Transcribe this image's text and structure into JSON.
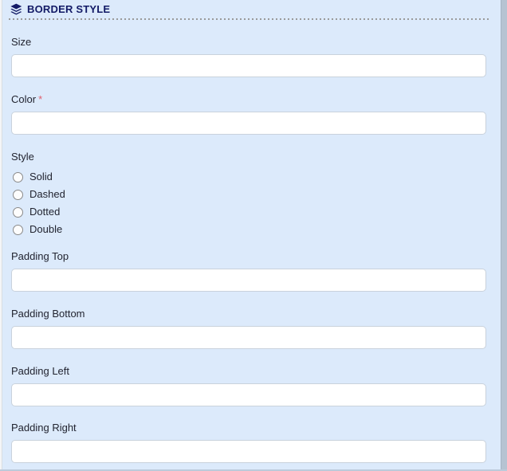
{
  "section": {
    "title": "BORDER STYLE",
    "icon": "layers-icon"
  },
  "fields": {
    "size": {
      "label": "Size",
      "value": "",
      "placeholder": ""
    },
    "color": {
      "label": "Color",
      "required_marker": "*",
      "value": "",
      "placeholder": ""
    },
    "style": {
      "label": "Style",
      "options": [
        "Solid",
        "Dashed",
        "Dotted",
        "Double"
      ],
      "selected": ""
    },
    "padding_top": {
      "label": "Padding Top",
      "value": "",
      "placeholder": ""
    },
    "padding_bottom": {
      "label": "Padding Bottom",
      "value": "",
      "placeholder": ""
    },
    "padding_left": {
      "label": "Padding Left",
      "value": "",
      "placeholder": ""
    },
    "padding_right": {
      "label": "Padding Right",
      "value": "",
      "placeholder": ""
    }
  },
  "colors": {
    "background": "#dceafb",
    "header_text": "#121a66",
    "label_text": "#222430",
    "input_border": "#c9d2dc",
    "input_background": "#ffffff",
    "dotted_divider": "#9a9a9a",
    "right_rail": "#b6c3d2",
    "required_marker": "#e0606e"
  }
}
